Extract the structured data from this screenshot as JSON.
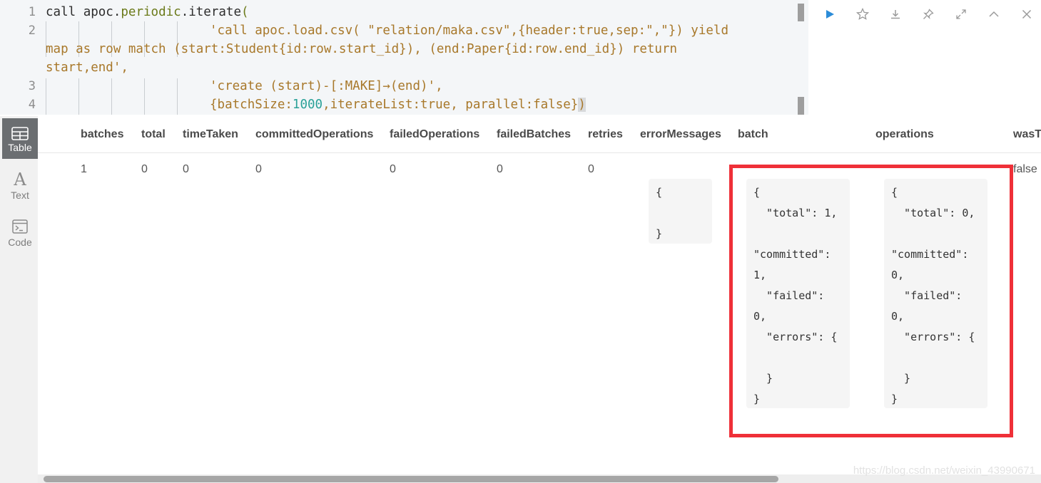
{
  "editor": {
    "line_numbers": [
      "1",
      "2",
      "",
      "",
      "3",
      "4"
    ],
    "line1": {
      "call": "call ",
      "apoc": "apoc",
      "dot1": ".",
      "periodic": "periodic",
      "dot2": ".",
      "iterate": "iterate",
      "paren": "("
    },
    "line2a": "'call apoc.load.csv( \"relation/maka.csv\",{header:true,sep:\",\"}) yield",
    "line2b": "map as row match (start:Student{id:row.start_id}), (end:Paper{id:row.end_id}) return",
    "line2c": "start,end',",
    "line3": "'create (start)-[:MAKE]→(end)',",
    "line4": {
      "open": "{",
      "k1": "batchSize:",
      "v1": "1000",
      "c1": ",",
      "k2": "iterateList:",
      "v2": "true",
      "c2": ", ",
      "k3": "parallel:",
      "v3": "false",
      "close": "}",
      "paren": ")"
    }
  },
  "toolbar": {
    "icons": [
      "run-icon",
      "star-icon",
      "download-icon",
      "pin-icon",
      "expand-icon",
      "collapse-icon",
      "close-icon"
    ],
    "accent": "#2b8cd8"
  },
  "sidebar": {
    "views": [
      {
        "label": "Table",
        "icon": "table-icon",
        "active": true
      },
      {
        "label": "Text",
        "icon": "text-icon",
        "active": false
      },
      {
        "label": "Code",
        "icon": "code-icon",
        "active": false
      }
    ]
  },
  "table": {
    "headers": [
      "batches",
      "total",
      "timeTaken",
      "committedOperations",
      "failedOperations",
      "failedBatches",
      "retries",
      "errorMessages",
      "batch",
      "operations",
      "wasT"
    ],
    "row": {
      "batches": "1",
      "total": "0",
      "timeTaken": "0",
      "committedOperations": "0",
      "failedOperations": "0",
      "failedBatches": "0",
      "retries": "0",
      "errorMessages": "{\n\n}",
      "batch": "{\n  \"total\": 1,\n\n\"committed\":\n1,\n  \"failed\":\n0,\n  \"errors\": {\n\n  }\n}",
      "operations": "{\n  \"total\": 0,\n\n\"committed\":\n0,\n  \"failed\":\n0,\n  \"errors\": {\n\n  }\n}",
      "wasTerminated": "false"
    }
  },
  "highlight_color": "#ef3038",
  "watermark": "https://blog.csdn.net/weixin_43990671"
}
